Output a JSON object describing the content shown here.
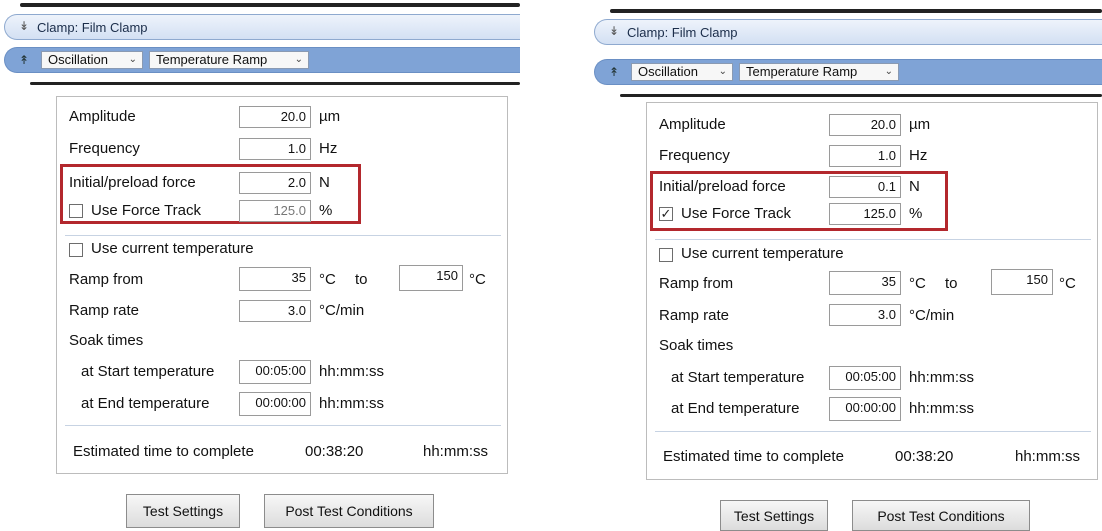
{
  "left": {
    "clamp_title": "Clamp: Film Clamp",
    "mode_dropdown": "Oscillation",
    "test_dropdown": "Temperature Ramp",
    "amplitude": {
      "label": "Amplitude",
      "value": "20.0",
      "unit": "µm"
    },
    "frequency": {
      "label": "Frequency",
      "value": "1.0",
      "unit": "Hz"
    },
    "preload": {
      "label": "Initial/preload force",
      "value": "2.0",
      "unit": "N"
    },
    "force_track": {
      "label": "Use Force Track",
      "value": "125.0",
      "unit": "%",
      "checked": false
    },
    "use_current_temp": {
      "label": "Use current temperature",
      "checked": false
    },
    "ramp_from": {
      "label": "Ramp from",
      "from": "35",
      "unit1": "°C",
      "to_label": "to",
      "to": "150",
      "unit2": "°C"
    },
    "ramp_rate": {
      "label": "Ramp rate",
      "value": "3.0",
      "unit": "°C/min"
    },
    "soak_times": "Soak times",
    "soak_start": {
      "label": "at Start temperature",
      "value": "00:05:00",
      "unit": "hh:mm:ss"
    },
    "soak_end": {
      "label": "at End temperature",
      "value": "00:00:00",
      "unit": "hh:mm:ss"
    },
    "estimated": {
      "label": "Estimated time to complete",
      "value": "00:38:20",
      "unit": "hh:mm:ss"
    },
    "btn_test_settings": "Test Settings",
    "btn_post_test": "Post Test Conditions"
  },
  "right": {
    "clamp_title": "Clamp: Film Clamp",
    "mode_dropdown": "Oscillation",
    "test_dropdown": "Temperature Ramp",
    "amplitude": {
      "label": "Amplitude",
      "value": "20.0",
      "unit": "µm"
    },
    "frequency": {
      "label": "Frequency",
      "value": "1.0",
      "unit": "Hz"
    },
    "preload": {
      "label": "Initial/preload force",
      "value": "0.1",
      "unit": "N"
    },
    "force_track": {
      "label": "Use Force Track",
      "value": "125.0",
      "unit": "%",
      "checked": true
    },
    "use_current_temp": {
      "label": "Use current temperature",
      "checked": false
    },
    "ramp_from": {
      "label": "Ramp from",
      "from": "35",
      "unit1": "°C",
      "to_label": "to",
      "to": "150",
      "unit2": "°C"
    },
    "ramp_rate": {
      "label": "Ramp rate",
      "value": "3.0",
      "unit": "°C/min"
    },
    "soak_times": "Soak times",
    "soak_start": {
      "label": "at Start temperature",
      "value": "00:05:00",
      "unit": "hh:mm:ss"
    },
    "soak_end": {
      "label": "at End temperature",
      "value": "00:00:00",
      "unit": "hh:mm:ss"
    },
    "estimated": {
      "label": "Estimated time to complete",
      "value": "00:38:20",
      "unit": "hh:mm:ss"
    },
    "btn_test_settings": "Test Settings",
    "btn_post_test": "Post Test Conditions"
  },
  "icons": {
    "collapse": "double-chevron-down-icon",
    "expand": "double-chevron-up-icon",
    "dropdown": "chevron-down-icon",
    "check": "checkmark-icon"
  },
  "colors": {
    "header_blue": "#7fa3d6",
    "highlight_red": "#b3282d"
  }
}
